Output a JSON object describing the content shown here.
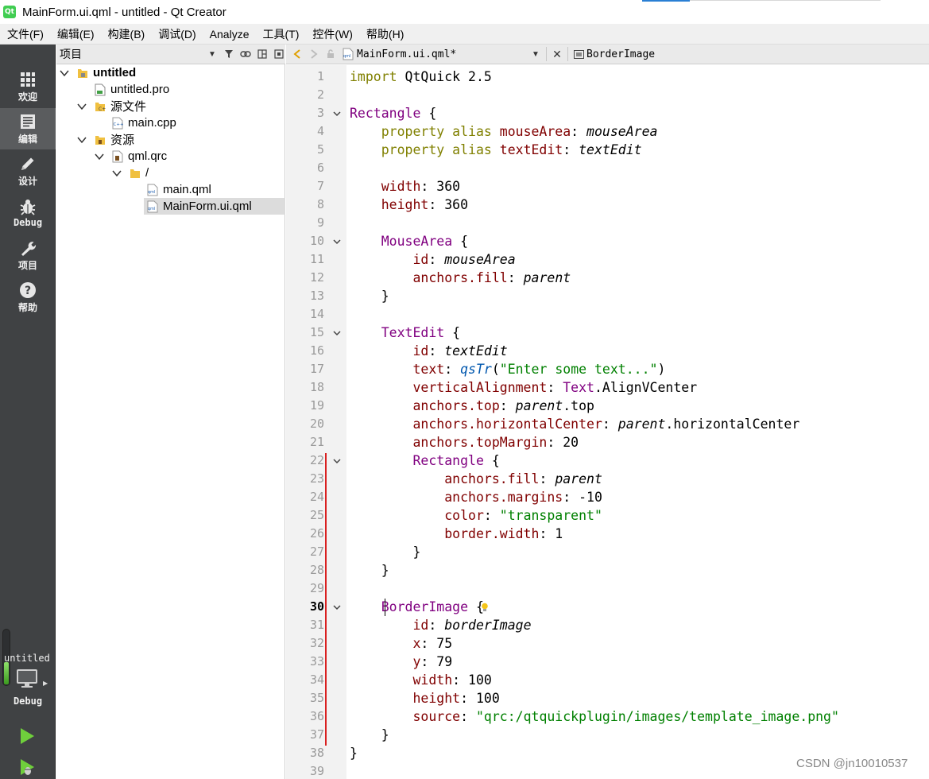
{
  "window": {
    "title": "MainForm.ui.qml - untitled - Qt Creator",
    "app_icon_text": "Qt"
  },
  "menu": [
    "文件(F)",
    "编辑(E)",
    "构建(B)",
    "调试(D)",
    "Analyze",
    "工具(T)",
    "控件(W)",
    "帮助(H)"
  ],
  "modes": [
    {
      "label": "欢迎",
      "icon": "grid-icon"
    },
    {
      "label": "编辑",
      "icon": "edit-document-icon",
      "active": true
    },
    {
      "label": "设计",
      "icon": "pencil-icon"
    },
    {
      "label": "Debug",
      "icon": "bug-icon"
    },
    {
      "label": "项目",
      "icon": "wrench-icon"
    },
    {
      "label": "帮助",
      "icon": "help-icon"
    }
  ],
  "kit": {
    "project": "untitled",
    "config": "Debug"
  },
  "project_pane": {
    "combo_label": "项目",
    "tree": [
      {
        "label": "untitled",
        "bold": true,
        "expanded": true,
        "icon": "project-folder-icon"
      },
      {
        "label": "untitled.pro",
        "icon": "pro-file-icon"
      },
      {
        "label": "源文件",
        "expanded": true,
        "icon": "source-folder-icon"
      },
      {
        "label": "main.cpp",
        "icon": "cpp-file-icon"
      },
      {
        "label": "资源",
        "expanded": true,
        "icon": "resource-folder-icon"
      },
      {
        "label": "qml.qrc",
        "expanded": true,
        "icon": "qrc-file-icon"
      },
      {
        "label": "/",
        "expanded": true,
        "icon": "folder-icon"
      },
      {
        "label": "main.qml",
        "icon": "qml-file-icon"
      },
      {
        "label": "MainForm.ui.qml",
        "icon": "qml-file-icon",
        "selected": true
      }
    ]
  },
  "editor_toolbar": {
    "document": "MainForm.ui.qml*",
    "symbol": "BorderImage"
  },
  "editor": {
    "current_line": 30,
    "fold_lines": [
      3,
      10,
      15,
      22,
      30
    ],
    "lines": [
      [
        [
          "kw",
          "import"
        ],
        [
          "p",
          " QtQuick 2.5"
        ]
      ],
      [],
      [
        [
          "type",
          "Rectangle"
        ],
        [
          "p",
          " {"
        ]
      ],
      [
        [
          "p",
          "    "
        ],
        [
          "kw",
          "property alias"
        ],
        [
          "p",
          " "
        ],
        [
          "prop",
          "mouseArea"
        ],
        [
          "p",
          ": "
        ],
        [
          "idref",
          "mouseArea"
        ]
      ],
      [
        [
          "p",
          "    "
        ],
        [
          "kw",
          "property alias"
        ],
        [
          "p",
          " "
        ],
        [
          "prop",
          "textEdit"
        ],
        [
          "p",
          ": "
        ],
        [
          "idref",
          "textEdit"
        ]
      ],
      [],
      [
        [
          "p",
          "    "
        ],
        [
          "prop",
          "width"
        ],
        [
          "p",
          ": 360"
        ]
      ],
      [
        [
          "p",
          "    "
        ],
        [
          "prop",
          "height"
        ],
        [
          "p",
          ": 360"
        ]
      ],
      [],
      [
        [
          "p",
          "    "
        ],
        [
          "type",
          "MouseArea"
        ],
        [
          "p",
          " {"
        ]
      ],
      [
        [
          "p",
          "        "
        ],
        [
          "prop",
          "id"
        ],
        [
          "p",
          ": "
        ],
        [
          "idref",
          "mouseArea"
        ]
      ],
      [
        [
          "p",
          "        "
        ],
        [
          "prop",
          "anchors.fill"
        ],
        [
          "p",
          ": "
        ],
        [
          "idref",
          "parent"
        ]
      ],
      [
        [
          "p",
          "    }"
        ]
      ],
      [],
      [
        [
          "p",
          "    "
        ],
        [
          "type",
          "TextEdit"
        ],
        [
          "p",
          " {"
        ]
      ],
      [
        [
          "p",
          "        "
        ],
        [
          "prop",
          "id"
        ],
        [
          "p",
          ": "
        ],
        [
          "idref",
          "textEdit"
        ]
      ],
      [
        [
          "p",
          "        "
        ],
        [
          "prop",
          "text"
        ],
        [
          "p",
          ": "
        ],
        [
          "fn",
          "qsTr"
        ],
        [
          "p",
          "("
        ],
        [
          "str",
          "\"Enter some text...\""
        ],
        [
          "p",
          ")"
        ]
      ],
      [
        [
          "p",
          "        "
        ],
        [
          "prop",
          "verticalAlignment"
        ],
        [
          "p",
          ": "
        ],
        [
          "type",
          "Text"
        ],
        [
          "p",
          ".AlignVCenter"
        ]
      ],
      [
        [
          "p",
          "        "
        ],
        [
          "prop",
          "anchors.top"
        ],
        [
          "p",
          ": "
        ],
        [
          "idref",
          "parent"
        ],
        [
          "p",
          ".top"
        ]
      ],
      [
        [
          "p",
          "        "
        ],
        [
          "prop",
          "anchors.horizontalCenter"
        ],
        [
          "p",
          ": "
        ],
        [
          "idref",
          "parent"
        ],
        [
          "p",
          ".horizontalCenter"
        ]
      ],
      [
        [
          "p",
          "        "
        ],
        [
          "prop",
          "anchors.topMargin"
        ],
        [
          "p",
          ": 20"
        ]
      ],
      [
        [
          "p",
          "        "
        ],
        [
          "type",
          "Rectangle"
        ],
        [
          "p",
          " {"
        ]
      ],
      [
        [
          "p",
          "            "
        ],
        [
          "prop",
          "anchors.fill"
        ],
        [
          "p",
          ": "
        ],
        [
          "idref",
          "parent"
        ]
      ],
      [
        [
          "p",
          "            "
        ],
        [
          "prop",
          "anchors.margins"
        ],
        [
          "p",
          ": -10"
        ]
      ],
      [
        [
          "p",
          "            "
        ],
        [
          "prop",
          "color"
        ],
        [
          "p",
          ": "
        ],
        [
          "str",
          "\"transparent\""
        ]
      ],
      [
        [
          "p",
          "            "
        ],
        [
          "prop",
          "border.width"
        ],
        [
          "p",
          ": 1"
        ]
      ],
      [
        [
          "p",
          "        }"
        ]
      ],
      [
        [
          "p",
          "    }"
        ]
      ],
      [],
      [
        [
          "p",
          "    "
        ],
        [
          "type",
          "BorderImage"
        ],
        [
          "p",
          " {"
        ]
      ],
      [
        [
          "p",
          "        "
        ],
        [
          "prop",
          "id"
        ],
        [
          "p",
          ": "
        ],
        [
          "idref",
          "borderImage"
        ]
      ],
      [
        [
          "p",
          "        "
        ],
        [
          "prop",
          "x"
        ],
        [
          "p",
          ": 75"
        ]
      ],
      [
        [
          "p",
          "        "
        ],
        [
          "prop",
          "y"
        ],
        [
          "p",
          ": 79"
        ]
      ],
      [
        [
          "p",
          "        "
        ],
        [
          "prop",
          "width"
        ],
        [
          "p",
          ": 100"
        ]
      ],
      [
        [
          "p",
          "        "
        ],
        [
          "prop",
          "height"
        ],
        [
          "p",
          ": 100"
        ]
      ],
      [
        [
          "p",
          "        "
        ],
        [
          "prop",
          "source"
        ],
        [
          "p",
          ": "
        ],
        [
          "str",
          "\"qrc:/qtquickplugin/images/template_image.png\""
        ]
      ],
      [
        [
          "p",
          "    }"
        ]
      ],
      [
        [
          "p",
          "}"
        ]
      ],
      []
    ]
  },
  "watermark": "CSDN @jn10010537",
  "colors": {
    "modebar": "#404244",
    "keyword": "#808000",
    "type": "#800080",
    "property": "#800000",
    "string": "#008000",
    "change_marker": "#d92020"
  }
}
